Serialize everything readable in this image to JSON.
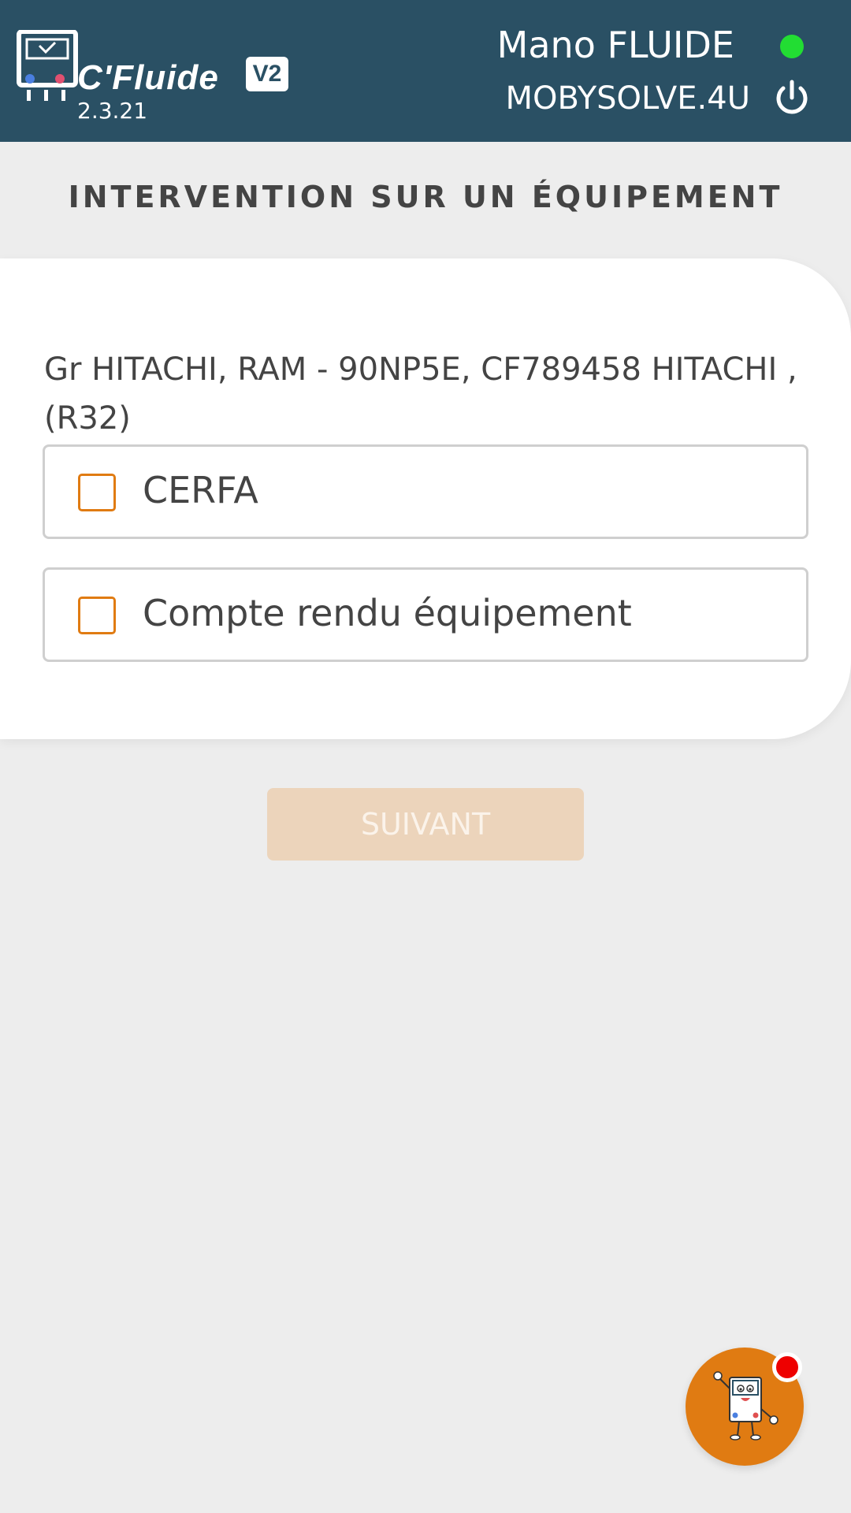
{
  "header": {
    "app_name": "C'Fluide",
    "app_badge": "V2",
    "version": "2.3.21",
    "user_name": "Mano FLUIDE",
    "company": "MOBYSOLVE.4U",
    "status_color": "#22dd33",
    "background_color": "#2a5064",
    "icons": [
      "logo-icon",
      "status-dot",
      "power-icon"
    ]
  },
  "main": {
    "title": "INTERVENTION SUR UN ÉQUIPEMENT",
    "equipment_label": "Gr HITACHI, RAM - 90NP5E, CF789458 HITACHI , (R32)",
    "options": [
      {
        "label": "CERFA",
        "checked": false
      },
      {
        "label": "Compte rendu équipement",
        "checked": false
      }
    ],
    "next_label": "SUIVANT",
    "next_enabled": false
  },
  "fab": {
    "icon": "mascot-icon",
    "notification": true,
    "accent_color": "#e07b12"
  }
}
